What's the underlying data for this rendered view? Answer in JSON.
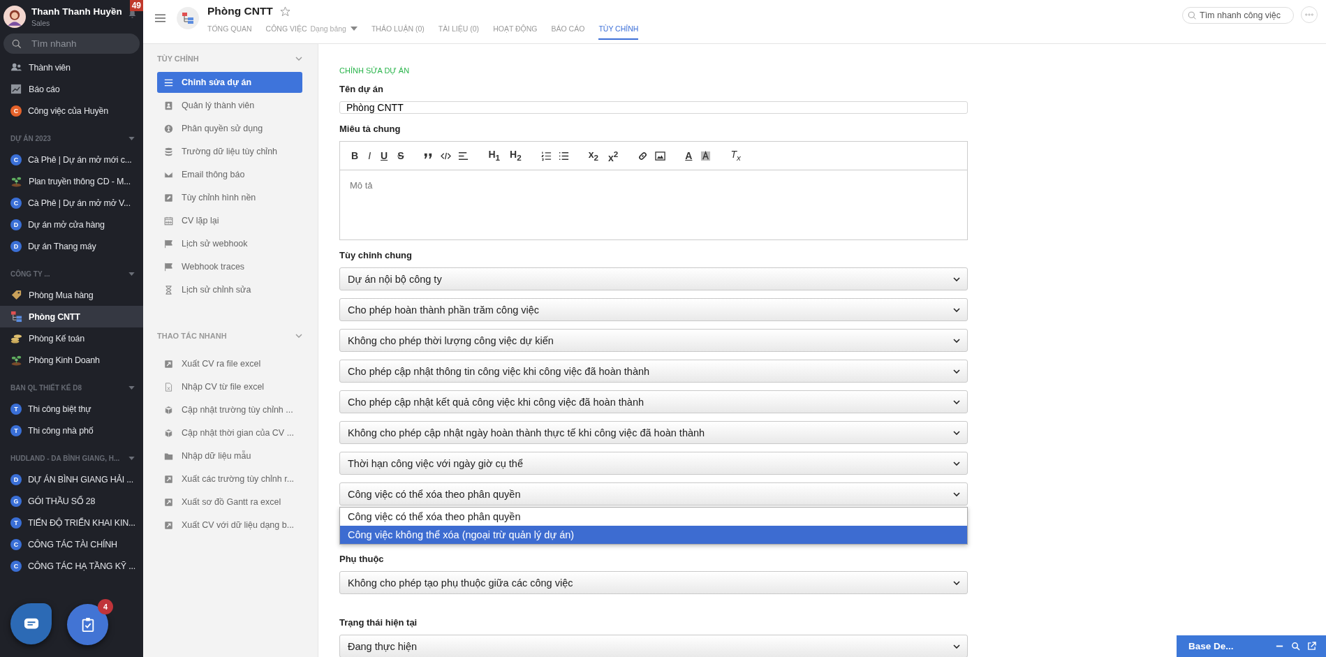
{
  "user": {
    "name": "Thanh Thanh Huyền",
    "role": "Sales",
    "notifications": "49"
  },
  "search": {
    "placeholder": "Tìm nhanh"
  },
  "nav": [
    {
      "label": "Thành viên",
      "kind": "members"
    },
    {
      "label": "Báo cáo",
      "kind": "chart"
    },
    {
      "label": "Công việc của Huyền",
      "kind": "letter",
      "letter": "C",
      "color": "#e5622a"
    }
  ],
  "groups": [
    {
      "title": "DỰ ÁN 2023",
      "items": [
        {
          "label": "Cà Phê | Dự án mở mới c...",
          "kind": "letter",
          "letter": "C",
          "color": "#3a6fd6",
          "selected": false
        },
        {
          "label": "Plan truyền thông CD - M...",
          "kind": "plant",
          "selected": false
        },
        {
          "label": "Cà Phê | Dự án mở mở V...",
          "kind": "letter",
          "letter": "C",
          "color": "#3a6fd6",
          "selected": false
        },
        {
          "label": "Dự án mở cửa hàng",
          "kind": "letter",
          "letter": "D",
          "color": "#3a6fd6",
          "selected": false
        },
        {
          "label": "Dự án Thang máy",
          "kind": "letter",
          "letter": "D",
          "color": "#3a6fd6",
          "selected": false
        }
      ]
    },
    {
      "title": "CÔNG TY ...",
      "items": [
        {
          "label": "Phòng Mua hàng",
          "kind": "tag",
          "selected": false
        },
        {
          "label": "Phòng CNTT",
          "kind": "org",
          "selected": true
        },
        {
          "label": "Phòng Kế toán",
          "kind": "coins",
          "selected": false
        },
        {
          "label": "Phòng Kinh Doanh",
          "kind": "plant",
          "selected": false
        }
      ]
    },
    {
      "title": "BAN QL THIẾT KẾ D8",
      "items": [
        {
          "label": "Thi công biệt thự",
          "kind": "letter",
          "letter": "T",
          "color": "#3a6fd6",
          "selected": false
        },
        {
          "label": "Thi công nhà phố",
          "kind": "letter",
          "letter": "T",
          "color": "#3a6fd6",
          "selected": false
        }
      ]
    },
    {
      "title": "HUDLAND - DA BÌNH GIANG, H...",
      "items": [
        {
          "label": "DỰ ÁN BÌNH GIANG HẢI ...",
          "kind": "letter",
          "letter": "D",
          "color": "#3a6fd6",
          "selected": false
        },
        {
          "label": "GÓI THẦU SỐ 28",
          "kind": "letter",
          "letter": "G",
          "color": "#3a6fd6",
          "selected": false
        },
        {
          "label": "TIẾN ĐỘ TRIỂN KHAI KIN...",
          "kind": "letter",
          "letter": "T",
          "color": "#3a6fd6",
          "selected": false
        },
        {
          "label": "CÔNG TÁC TÀI CHÍNH",
          "kind": "letter",
          "letter": "C",
          "color": "#3a6fd6",
          "selected": false
        },
        {
          "label": "CÔNG TÁC HẠ TẦNG KỸ ...",
          "kind": "letter",
          "letter": "C",
          "color": "#3a6fd6",
          "selected": false
        }
      ]
    }
  ],
  "task_fab": {
    "badge": "4"
  },
  "project": {
    "title": "Phòng CNTT",
    "tabs": [
      {
        "label": "TỔNG QUAN",
        "selected": false
      },
      {
        "label": "CÔNG VIỆC",
        "sub": "Dạng bảng",
        "selected": false
      },
      {
        "label": "THẢO LUẬN (0)",
        "selected": false
      },
      {
        "label": "TÀI LIỆU (0)",
        "selected": false
      },
      {
        "label": "HOẠT ĐỘNG",
        "selected": false
      },
      {
        "label": "BÁO CÁO",
        "selected": false
      },
      {
        "label": "TÙY CHỈNH",
        "selected": true
      }
    ]
  },
  "quick_search": {
    "placeholder": "Tìm nhanh công việc"
  },
  "settings_nav": [
    {
      "title": "TÙY CHỈNH",
      "items": [
        {
          "label": "Chỉnh sửa dự án",
          "kind": "lines",
          "selected": true
        },
        {
          "label": "Quản lý thành viên",
          "kind": "contact",
          "selected": false
        },
        {
          "label": "Phân quyền sử dụng",
          "kind": "person",
          "selected": false
        },
        {
          "label": "Trường dữ liệu tùy chỉnh",
          "kind": "database",
          "selected": false
        },
        {
          "label": "Email thông báo",
          "kind": "mail",
          "selected": false
        },
        {
          "label": "Tùy chỉnh hình nền",
          "kind": "pencil",
          "selected": false
        },
        {
          "label": "CV lặp lại",
          "kind": "calendar",
          "selected": false
        },
        {
          "label": "Lịch sử webhook",
          "kind": "flag",
          "selected": false
        },
        {
          "label": "Webhook traces",
          "kind": "flag",
          "selected": false
        },
        {
          "label": "Lịch sử chỉnh sửa",
          "kind": "hourglass",
          "selected": false
        }
      ]
    },
    {
      "title": "THAO TÁC NHANH",
      "items": [
        {
          "label": "Xuất CV ra file excel",
          "kind": "export",
          "selected": false
        },
        {
          "label": "Nhập CV từ file excel",
          "kind": "file",
          "selected": false
        },
        {
          "label": "Cập nhật trường tùy chỉnh ...",
          "kind": "cube",
          "selected": false
        },
        {
          "label": "Cập nhật thời gian của CV ...",
          "kind": "cube",
          "selected": false
        },
        {
          "label": "Nhập dữ liệu mẫu",
          "kind": "folder",
          "selected": false
        },
        {
          "label": "Xuất các trường tùy chỉnh r...",
          "kind": "export",
          "selected": false
        },
        {
          "label": "Xuất sơ đồ Gantt ra excel",
          "kind": "export",
          "selected": false
        },
        {
          "label": "Xuất CV với dữ liệu dạng b...",
          "kind": "export",
          "selected": false
        }
      ]
    }
  ],
  "form": {
    "heading": "CHỈNH SỬA DỰ ÁN",
    "name_label": "Tên dự án",
    "name_value": "Phòng CNTT",
    "desc_label": "Miêu tả chung",
    "desc_placeholder": "Mô tả",
    "toolbar": [
      [
        {
          "kind": "bold",
          "label": "B"
        },
        {
          "kind": "italic",
          "label": "I"
        },
        {
          "kind": "underline",
          "label": "U"
        },
        {
          "kind": "strike",
          "label": "S"
        }
      ],
      [
        {
          "kind": "quote"
        },
        {
          "kind": "code"
        },
        {
          "kind": "align"
        }
      ],
      [
        {
          "kind": "heading",
          "label": "H$_{1}$"
        },
        {
          "kind": "heading",
          "label": "H$_{2}$"
        }
      ],
      [
        {
          "kind": "ol"
        },
        {
          "kind": "ul"
        }
      ],
      [
        {
          "kind": "script",
          "label": "x$_{2}$"
        },
        {
          "kind": "script",
          "label": "x$^{2}$"
        }
      ],
      [
        {
          "kind": "link"
        },
        {
          "kind": "image"
        }
      ],
      [
        {
          "kind": "color",
          "label": "A"
        },
        {
          "kind": "highlight"
        }
      ],
      [
        {
          "kind": "clear",
          "label": "T$_{x}$"
        }
      ]
    ],
    "general_label": "Tùy chỉnh chung",
    "selects": [
      {
        "value": "Dự án nội bộ công ty"
      },
      {
        "value": "Cho phép hoàn thành phần trăm công việc"
      },
      {
        "value": "Không cho phép thời lượng công việc dự kiến"
      },
      {
        "value": "Cho phép cập nhật thông tin công việc khi công việc đã hoàn thành"
      },
      {
        "value": "Cho phép cập nhật kết quả công việc khi công việc đã hoàn thành"
      },
      {
        "value": "Không cho phép cập nhật ngày hoàn thành thực tế khi công việc đã hoàn thành"
      },
      {
        "value": "Thời hạn công việc với ngày giờ cụ thể"
      },
      {
        "value": "Công việc có thể xóa theo phân quyền",
        "open": true,
        "options": [
          {
            "label": "Công việc có thể xóa theo phân quyền",
            "highlighted": false
          },
          {
            "label": "Công việc không thể xóa (ngoại trừ quản lý dự án)",
            "highlighted": true
          }
        ]
      }
    ],
    "sections": [
      {
        "label": "Phụ thuộc",
        "value": "Không cho phép tạo phụ thuộc giữa các công việc"
      },
      {
        "label": "Trạng thái hiện tại",
        "value": "Đang thực hiện"
      }
    ]
  },
  "widget": {
    "title": "Base De..."
  }
}
